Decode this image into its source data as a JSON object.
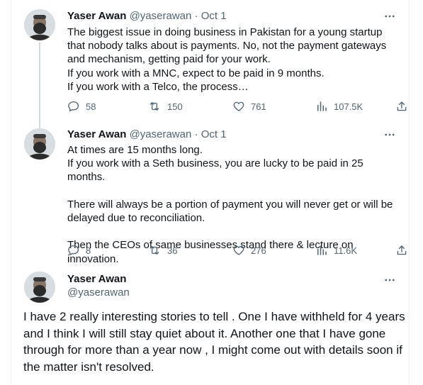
{
  "tweets": [
    {
      "name": "Yaser Awan",
      "handle": "@yaserawan",
      "separator": "·",
      "date": "Oct 1",
      "text": "The biggest issue in doing business in Pakistan for a young startup that nobody talks about is payments. No, not the payment gateways and mechanism, getting paid for your work.\nIf you work with a MNC, expect to be paid in 9 months.\nIf you work with a Telco, the process…",
      "replies": "58",
      "reposts": "150",
      "likes": "761",
      "views": "107.5K"
    },
    {
      "name": "Yaser Awan",
      "handle": "@yaserawan",
      "separator": "·",
      "date": "Oct 1",
      "text": "At times are 15 months long.\nIf you work with a Seth business, you are lucky to be paid in 25 months.\n\nThere will always be a portion of payment you will never get or will be delayed due to reconciliation.\n\nThen the CEOs of same businesses stand there & lecture on innovation.",
      "replies": "8",
      "reposts": "36",
      "likes": "276",
      "views": "11.6K"
    }
  ],
  "main_tweet": {
    "name": "Yaser Awan",
    "handle": "@yaserawan",
    "text": "I have 2 really interesting stories to tell . One I have withheld for 4 years and I think I will still stay quiet about it. Another one that I have gone through for more than a year now , I might come out with details soon if the matter isn't resolved."
  },
  "icons": {
    "reply": "reply-bubble-icon",
    "repost": "repost-arrows-icon",
    "like": "heart-icon",
    "views": "views-bar-chart-icon",
    "share": "share-upload-icon",
    "more": "more-dots-icon"
  },
  "colors": {
    "text": "#0f1419",
    "secondary": "#536471",
    "line": "#cfd9de",
    "border": "#eff3f4"
  }
}
